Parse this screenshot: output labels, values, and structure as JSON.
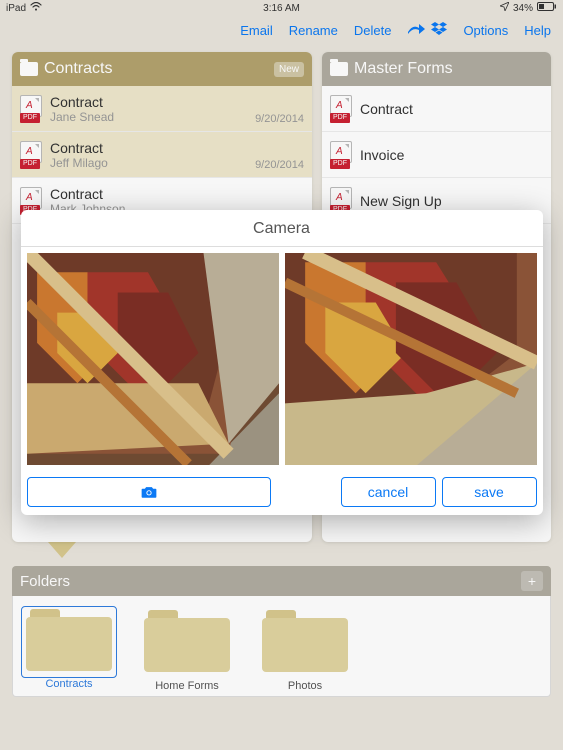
{
  "status": {
    "device": "iPad",
    "wifi": "◴",
    "time": "3:16 AM",
    "battery_pct": "34%",
    "battery_icon": "▯"
  },
  "toolbar": {
    "email": "Email",
    "rename": "Rename",
    "delete": "Delete",
    "options": "Options",
    "help": "Help"
  },
  "contracts_card": {
    "title": "Contracts",
    "new_badge": "New",
    "rows": [
      {
        "title": "Contract",
        "sub": "Jane Snead",
        "date": "9/20/2014"
      },
      {
        "title": "Contract",
        "sub": "Jeff Milago",
        "date": "9/20/2014"
      },
      {
        "title": "Contract",
        "sub": "Mark Johnson",
        "date": ""
      }
    ]
  },
  "master_card": {
    "title": "Master Forms",
    "rows": [
      {
        "title": "Contract"
      },
      {
        "title": "Invoice"
      },
      {
        "title": "New Sign Up"
      }
    ]
  },
  "pdf_tag": "PDF",
  "folders": {
    "header": "Folders",
    "items": [
      {
        "label": "Contracts"
      },
      {
        "label": "Home Forms"
      },
      {
        "label": "Photos"
      }
    ]
  },
  "modal": {
    "title": "Camera",
    "cancel": "cancel",
    "save": "save"
  }
}
